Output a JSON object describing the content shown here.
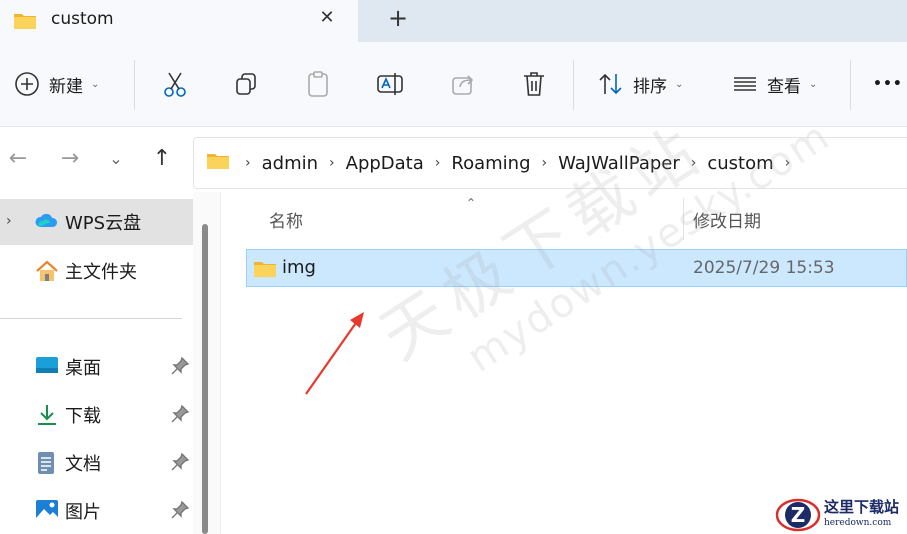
{
  "tab": {
    "title": "custom",
    "close": "✕",
    "new_tab": "+"
  },
  "commands": {
    "new_label": "新建",
    "sort_label": "排序",
    "view_label": "查看",
    "more": "•••"
  },
  "address": {
    "crumbs": [
      "admin",
      "AppData",
      "Roaming",
      "WaJWallPaper",
      "custom"
    ]
  },
  "sidebar": {
    "items": [
      {
        "label": "WPS云盘",
        "icon": "cloud-icon",
        "selected": true
      },
      {
        "label": "主文件夹",
        "icon": "home-icon"
      },
      {
        "label": "桌面",
        "icon": "desktop-icon",
        "pinned": true
      },
      {
        "label": "下载",
        "icon": "download-icon",
        "pinned": true
      },
      {
        "label": "文档",
        "icon": "document-icon",
        "pinned": true
      },
      {
        "label": "图片",
        "icon": "pictures-icon",
        "pinned": true
      }
    ]
  },
  "list": {
    "columns": {
      "name": "名称",
      "modified": "修改日期"
    },
    "rows": [
      {
        "name": "img",
        "modified": "2025/7/29 15:53",
        "selected": true
      }
    ]
  },
  "watermark": {
    "cn": "天极下载站",
    "en": "mydown.yesky.com"
  },
  "logo": {
    "cn": "这里下载站",
    "en": "heredown.com"
  },
  "colors": {
    "selection": "#cce8ff",
    "folder": "#f8c94a",
    "accent": "#0067c0",
    "arrow": "#e8392b"
  }
}
